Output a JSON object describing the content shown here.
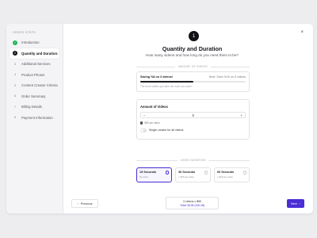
{
  "sidebar": {
    "heading": "ORDER STEPS",
    "steps": [
      {
        "num": "✓",
        "label": "Introduction",
        "state": "done"
      },
      {
        "num": "2",
        "label": "Quantity and Duration",
        "state": "active"
      },
      {
        "num": "3",
        "label": "Additional Services",
        "state": ""
      },
      {
        "num": "4",
        "label": "Product Photos",
        "state": ""
      },
      {
        "num": "5",
        "label": "Content Creator Criteria",
        "state": ""
      },
      {
        "num": "6",
        "label": "Order Summary",
        "state": ""
      },
      {
        "num": "7",
        "label": "Billing Details",
        "state": ""
      },
      {
        "num": "8",
        "label": "Payment Information",
        "state": ""
      }
    ],
    "active_chevron": "›"
  },
  "close_icon": "×",
  "main": {
    "badge": "1",
    "title": "Quantity and Duration",
    "subtitle": "How many videos and how long do you need them to be?"
  },
  "savings": {
    "heading": "AMOUNT OF VIDEOS",
    "left": "Saving %8 on 3 videos!",
    "right": "Next: Save %10 on 6 videos",
    "progress": 0.5,
    "note": "The more videos you add, the more you save!"
  },
  "amount": {
    "title": "Amount of Videos",
    "minus": "−",
    "value": "3",
    "plus": "+",
    "price_note": "$50 per video",
    "info_icon": "i",
    "toggle_label": "Single creator for all videos."
  },
  "durations": {
    "heading": "VIDEO DURATION",
    "options": [
      {
        "name": "15 Seconds",
        "sub": "No extra",
        "selected": true
      },
      {
        "name": "30 Seconds",
        "sub": "+ $15 per video",
        "selected": false
      },
      {
        "name": "60 Seconds",
        "sub": "+ $20 per video",
        "selected": false
      }
    ]
  },
  "footer": {
    "prev_label": "Previous",
    "prev_icon": "‹",
    "summary_line1": "3 videos x $50",
    "summary_line2": "Total: $138 (%8 off)",
    "next_label": "Next",
    "next_icon": "›"
  },
  "colors": {
    "accent": "#4b2dd6",
    "done": "#22b35a",
    "background": "#ededf0"
  }
}
